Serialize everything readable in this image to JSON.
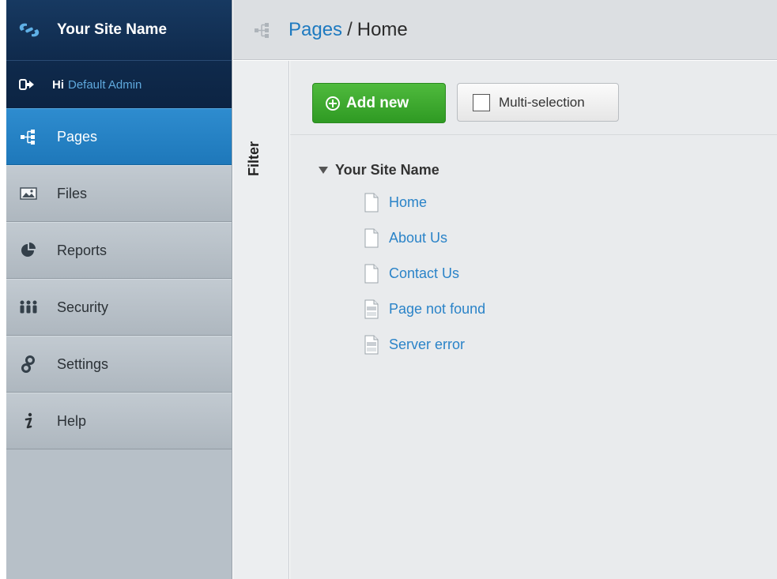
{
  "sidebar": {
    "brand": {
      "title": "Your Site Name",
      "logo_icon": "link-logo-icon"
    },
    "user": {
      "greeting": "Hi",
      "name": "Default Admin",
      "icon": "sign-out-icon"
    },
    "items": [
      {
        "label": "Pages",
        "icon": "sitemap-icon",
        "active": true
      },
      {
        "label": "Files",
        "icon": "image-icon",
        "active": false
      },
      {
        "label": "Reports",
        "icon": "pie-chart-icon",
        "active": false
      },
      {
        "label": "Security",
        "icon": "users-icon",
        "active": false
      },
      {
        "label": "Settings",
        "icon": "gears-icon",
        "active": false
      },
      {
        "label": "Help",
        "icon": "info-icon",
        "active": false
      }
    ]
  },
  "header": {
    "icon": "sitemap-icon",
    "breadcrumb_root": "Pages",
    "separator": "/",
    "current": "Home"
  },
  "filter": {
    "label": "Filter"
  },
  "toolbar": {
    "add_new_label": "Add new",
    "multi_selection_label": "Multi-selection"
  },
  "tree": {
    "root": "Your Site Name",
    "children": [
      {
        "label": "Home",
        "icon": "page-icon"
      },
      {
        "label": "About Us",
        "icon": "page-icon"
      },
      {
        "label": "Contact Us",
        "icon": "page-icon"
      },
      {
        "label": "Page not found",
        "icon": "error-page-icon"
      },
      {
        "label": "Server error",
        "icon": "error-page-icon"
      }
    ]
  },
  "colors": {
    "brand_bg": "#173961",
    "active_nav": "#2e8ccf",
    "link": "#2a83c8",
    "add_button": "#3aa62c"
  }
}
